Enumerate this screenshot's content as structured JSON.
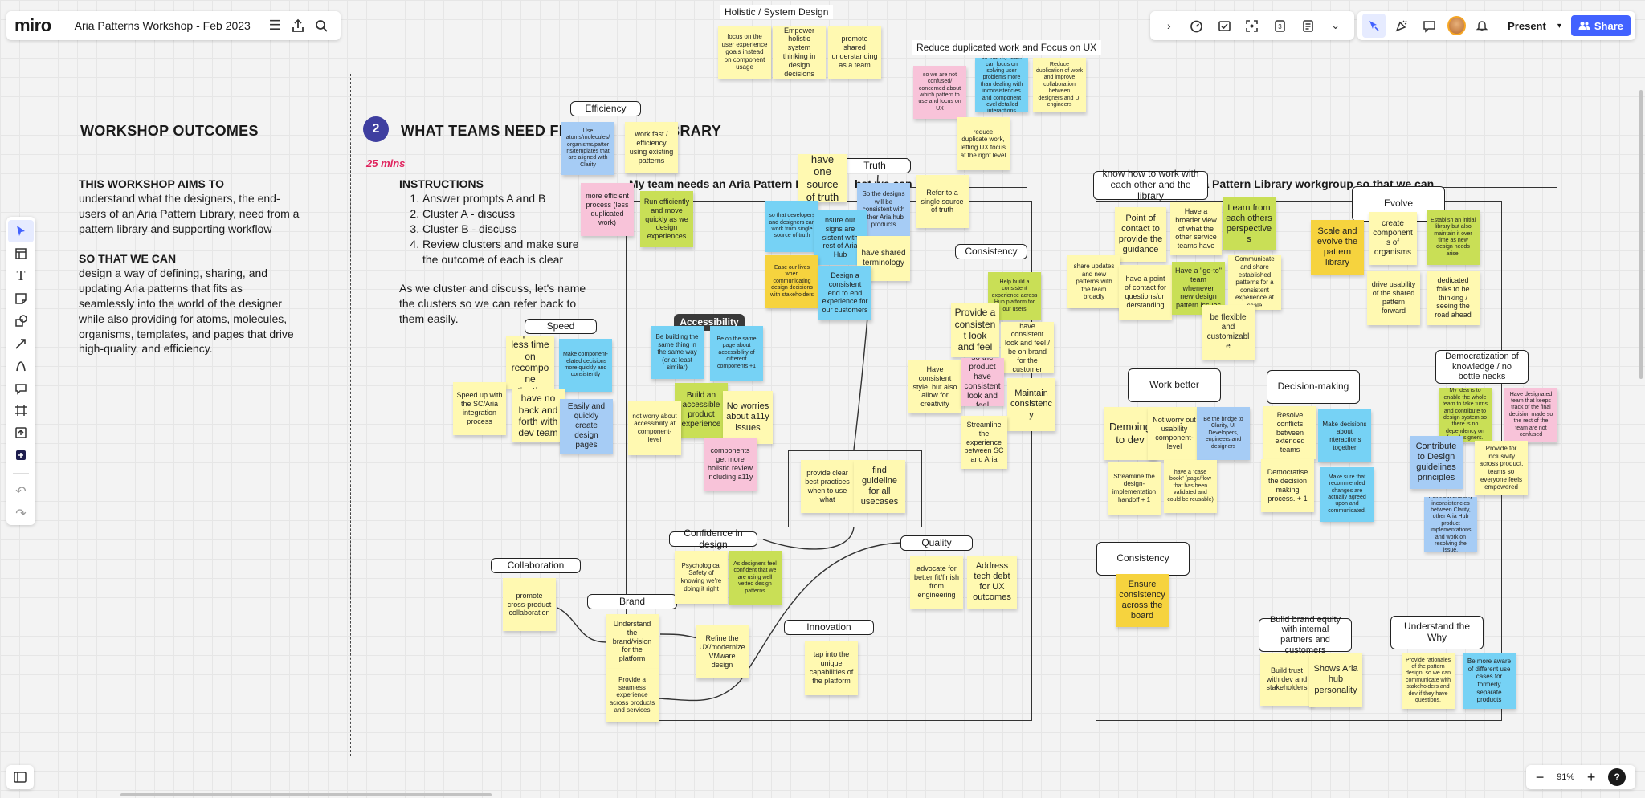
{
  "app": {
    "logo": "miro",
    "board_title": "Aria Patterns Workshop - Feb 2023",
    "present_label": "Present",
    "share_label": "Share",
    "zoom": "91%",
    "help": "?"
  },
  "left": {
    "heading": "WORKSHOP OUTCOMES",
    "aims_heading": "THIS WORKSHOP AIMS TO",
    "aims_text": "understand what the designers, the end-users of an Aria Pattern Library, need from a pattern library and supporting workflow",
    "so_heading": "SO THAT WE CAN",
    "so_text": "design a way of defining, sharing, and updating Aria patterns that fits as seamlessly into the world of the designer while also providing for  atoms, molecules, organisms, templates, and pages that drive high-quality, and efficiency."
  },
  "middle": {
    "step_number": "2",
    "heading": "WHAT TEAMS NEED FRO",
    "heading_tail": "T LIBRARY",
    "duration": "25 mins",
    "instructions_heading": "INSTRUCTIONS",
    "steps": [
      "Answer prompts A and B",
      "Cluster A - discuss",
      "Cluster B - discuss",
      "Review clusters and make sure the outcome of each is clear"
    ],
    "note": "As we cluster and discuss, let's name the clusters so we can refer back to them easily.",
    "prompt_a": "My team needs an Aria Pattern L",
    "prompt_a_tail": "hat we can",
    "prompt_b": "ria Pattern Library workgroup so that we can"
  },
  "floating_labels": {
    "holistic": "Holistic / System Design",
    "reduce": "Reduce duplicated work and Focus on UX"
  },
  "labels": [
    "Efficiency",
    "Truth",
    "Consistency",
    "Speed",
    "Accessibility",
    "Confidence in design",
    "Quality",
    "Collaboration",
    "Brand",
    "Innovation",
    "know how to work with each other and the library",
    "Evolve",
    "Work better",
    "Decision-making",
    "Democratization of knowledge / no bottle necks",
    "Consistency",
    "Build brand equity with internal partners and customers",
    "Understand the Why"
  ],
  "stickies": [
    "focus on the user experience goals instead on component usage",
    "Empower holistic system thinking in design decisions",
    "promote shared understanding as a team",
    "so we are not confused/ concerned about which pattern to use and focus on UX",
    "so that my team can focus on solving user problems more than dealing with inconsistencies and component level detailed interactions",
    "Reduce duplication of work and improve collaboration between designers and UI engineers",
    "reduce duplicate work, letting UX focus at the right level",
    "Use atoms/molecules/ organisms/patter ns/templates that are aligned with Clarity",
    "work fast / efficiency using existing patterns",
    "more efficient process (less duplicated work)",
    "Run efficiently and move quickly as we design experiences",
    "have one source of truth",
    "So the designs will be consistent with other Aria hub products",
    "Refer to a single source of truth",
    "so that developers and designers can work from single source of truth",
    "nsure our signs are sistent with rest of Aria Hub",
    "have shared terminology",
    "Ease our lives when communicating design decisions with stakeholders",
    "Design a consistent end to end experience for our customers",
    "Help build a consistent experience across Hub platform for our users",
    "Provide a consistent look and feel",
    "have consistent look and feel / be on brand for the customer",
    "Have consistent style, but also allow for creativity",
    "so the product have consistent look and feel",
    "Maintain consistency",
    "Streamline the experience between SC and Aria",
    "Spend less time on recompone ntization",
    "Make component-related decisions more quickly and consistently",
    "have no back and forth with dev team",
    "Speed up with the SC/Aria integration process",
    "Easily and quickly create design pages",
    "Be building the same thing in the same way (or at least similar)",
    "Be on the same page about accessibility of different components +1",
    "Build an accessible product experience",
    "No worries about a11y issues",
    "not worry about accessibility at component-level",
    "components get more holistic review including a11y",
    "provide clear best practices when to use what",
    "find guideline for all usecases",
    "Psychological Safety of knowing we're doing it right",
    "As designers feel confident that we are using well vetted design patterns",
    "advocate for better fit/finish from engineering",
    "Address tech debt for UX outcomes",
    "promote cross-product collaboration",
    "Understand the brand/vision for the platform",
    "Refine the UX/modernize VMware design",
    "Provide a seamless experience across products and services",
    "tap into the unique capabilities of the platform",
    "Point of contact to provide the guidance",
    "Have a broader view of what the other service teams have",
    "Learn from each others perspectives",
    "share updates and new patterns with the team broadly",
    "have a point of contact for questions/un derstanding",
    "Have a \"go-to\" team whenever new design pattern issues",
    "Communicate and share established patterns for a consistent experience at scale",
    "be flexible and customizable",
    "Scale and evolve the pattern library",
    "create components of organisms",
    "Establish an initial library but also maintain it over time as new design needs arise.",
    "drive usability of the shared pattern forward",
    "dedicated folks to be thinking / seeing the road ahead",
    "Demoing to dev",
    "Not worry out usability component-level",
    "Be the bridge to Clarity, UI Developers, engineers and designers",
    "Streamline the design-implementation handoff + 1",
    "have a \"case book\" (page/flow that has been validated and could be reusable)",
    "Resolve conflicts between extended teams",
    "Make decisions about interactions together",
    "Democratise the decision making process. + 1",
    "Make sure that recommended changes are actually agreed upon and communicated.",
    "My idea is to enable the whole team to take turns and contribute to design system so there is no dependency on few designers.",
    "Have designated team that keeps track of the final decision made so the rest of the team are not confused",
    "Contribute to Design guidelines principles",
    "Provide for inclusivity across product. teams so everyone feels empowered",
    "Point out and any inconsistencies between Clarity, other Aria Hub product implementations and work on resolving the issue.",
    "Ensure consistency across the board",
    "Build trust with dev and stakeholders",
    "Shows Aria hub personality",
    "Provide rationales of the pattern design, so we can communicate with stakeholders and dev if they have questions.",
    "Be more aware of different use cases for formerly separate products"
  ],
  "colors": {
    "share_button": "#4262ff",
    "step_circle": "#3f3fa0",
    "duration": "#e0245e"
  }
}
